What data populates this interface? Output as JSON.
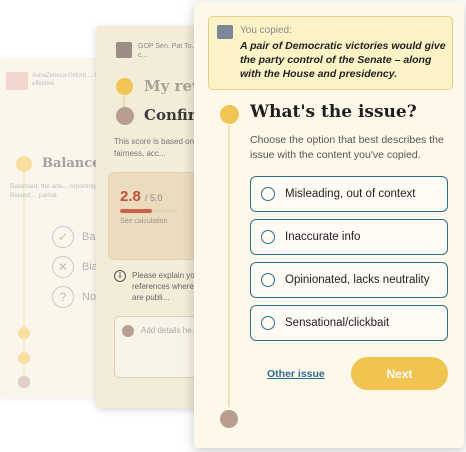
{
  "back_card": {
    "source_text": "AstraZeneca-Oxford ... 90% effective",
    "title": "Balanced c",
    "description": "Balanced: the arte... reporting. Biased:... partial.",
    "options": [
      {
        "label": "Bal",
        "icon": "check-circle-icon",
        "glyph": "✓"
      },
      {
        "label": "Bias",
        "icon": "x-circle-icon",
        "glyph": "✕"
      },
      {
        "label": "Not",
        "icon": "question-circle-icon",
        "glyph": "?"
      }
    ]
  },
  "middle_card": {
    "source_text": "GOP Sen. Pat To... plausible legal c...",
    "step_review": "My revie",
    "step_confirm": "Confirm",
    "description": "This score is based on... content's fairness, acc...",
    "score": {
      "value": "2.8",
      "max": "/ 5.0",
      "fraction": 0.56,
      "calc_label": "See calculation"
    },
    "explain_text": "Please explain you... references where... Reviews are publi...",
    "details_placeholder": "Add details he..."
  },
  "front_card": {
    "copied_label": "You copied:",
    "copied_quote": "A pair of Democratic victories would give the party control of the Senate – along with the House and presidency.",
    "title": "What's the issue?",
    "description": "Choose the option that best describes the issue with the content you've copied.",
    "options": [
      {
        "label": "Misleading, out of context"
      },
      {
        "label": "Inaccurate info"
      },
      {
        "label": "Opinionated, lacks neutrality"
      },
      {
        "label": "Sensational/clickbait"
      }
    ],
    "other_issue": "Other issue",
    "next_button": "Next"
  },
  "colors": {
    "accent_yellow": "#f0c555",
    "option_border": "#2e6e8e",
    "card_bg": "#fdf8e9",
    "quote_bg": "#fbf2c6",
    "score_red": "#c2503a"
  }
}
